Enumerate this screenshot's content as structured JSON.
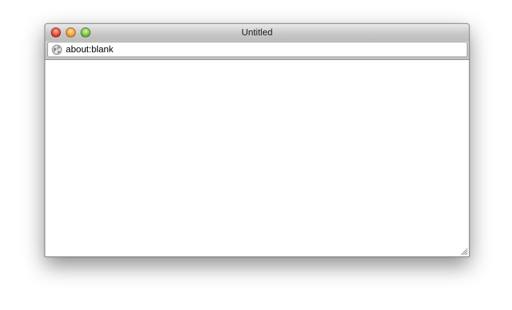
{
  "window": {
    "title": "Untitled",
    "buttons": {
      "close": "close-button",
      "minimize": "minimize-button",
      "zoom": "zoom-button"
    }
  },
  "address_bar": {
    "icon": "globe-icon",
    "url": "about:blank"
  },
  "colors": {
    "close": "#e24b3a",
    "minimize": "#f2a43a",
    "zoom": "#7ec24a"
  }
}
